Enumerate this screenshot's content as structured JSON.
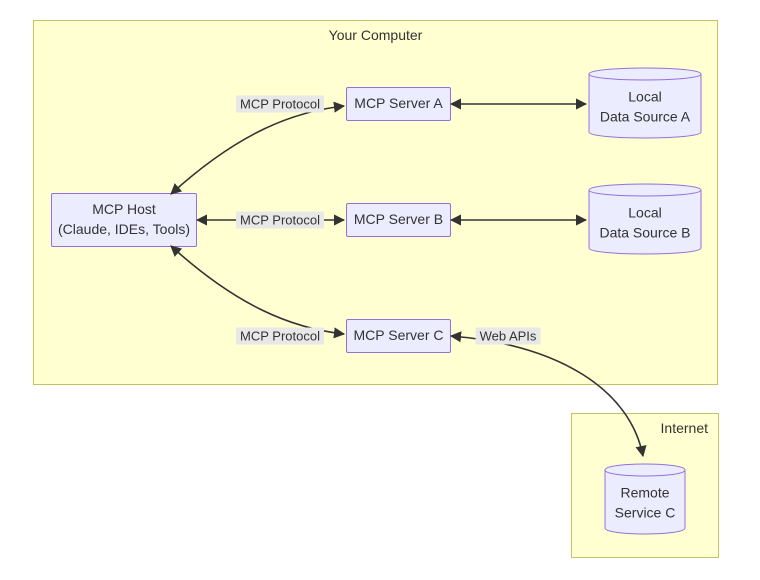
{
  "containers": {
    "computer": {
      "title": "Your Computer"
    },
    "internet": {
      "title": "Internet"
    }
  },
  "nodes": {
    "host": {
      "line1": "MCP Host",
      "line2": "(Claude, IDEs, Tools)"
    },
    "serverA": {
      "label": "MCP Server A"
    },
    "serverB": {
      "label": "MCP Server B"
    },
    "serverC": {
      "label": "MCP Server C"
    },
    "dataA": {
      "line1": "Local",
      "line2": "Data Source A"
    },
    "dataB": {
      "line1": "Local",
      "line2": "Data Source B"
    },
    "remote": {
      "line1": "Remote",
      "line2": "Service C"
    }
  },
  "edges": {
    "hostA": {
      "label": "MCP Protocol"
    },
    "hostB": {
      "label": "MCP Protocol"
    },
    "hostC": {
      "label": "MCP Protocol"
    },
    "webapi": {
      "label": "Web APIs"
    }
  },
  "colors": {
    "nodeFill": "#ECECFF",
    "nodeStroke": "#9370DB",
    "containerFill": "rgba(255,255,153,0.45)",
    "containerStroke": "rgba(170,170,51,0.7)",
    "edgeStroke": "#333333",
    "labelBg": "#e8e8e8"
  }
}
